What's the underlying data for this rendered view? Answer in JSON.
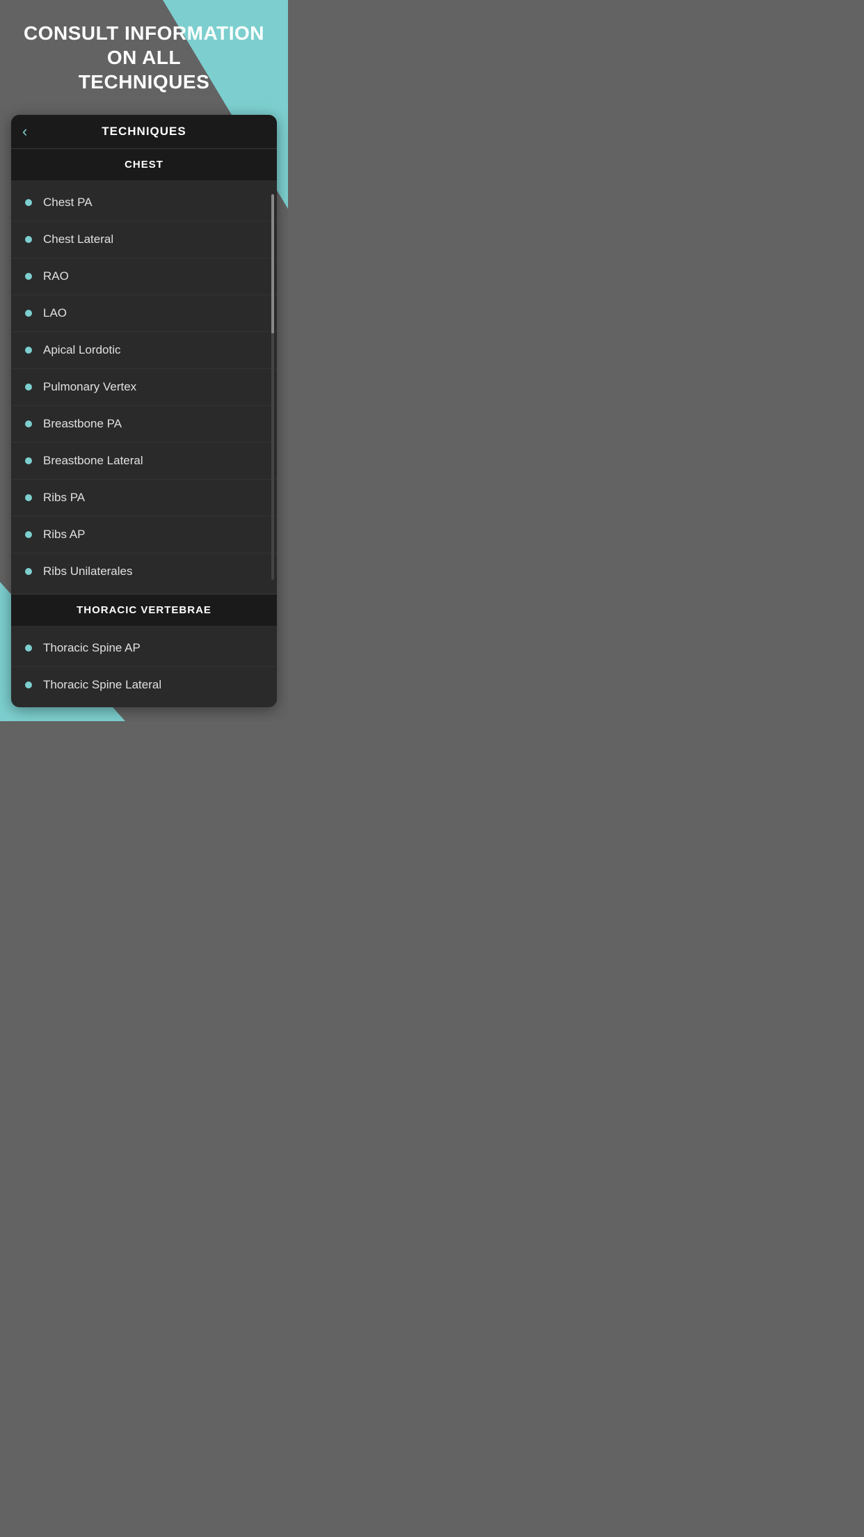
{
  "header": {
    "title": "CONSULT INFORMATION\nON ALL\nTECHNIQUES",
    "title_line1": "CONSULT INFORMATION",
    "title_line2": "ON ALL",
    "title_line3": "TECHNIQUES"
  },
  "card": {
    "nav_title": "TECHNIQUES",
    "back_label": "‹",
    "sections": [
      {
        "id": "chest",
        "label": "CHEST",
        "items": [
          {
            "id": "chest-pa",
            "label": "Chest PA"
          },
          {
            "id": "chest-lateral",
            "label": "Chest Lateral"
          },
          {
            "id": "rao",
            "label": "RAO"
          },
          {
            "id": "lao",
            "label": "LAO"
          },
          {
            "id": "apical-lordotic",
            "label": "Apical Lordotic"
          },
          {
            "id": "pulmonary-vertex",
            "label": "Pulmonary Vertex"
          },
          {
            "id": "breastbone-pa",
            "label": "Breastbone PA"
          },
          {
            "id": "breastbone-lateral",
            "label": "Breastbone Lateral"
          },
          {
            "id": "ribs-pa",
            "label": "Ribs PA"
          },
          {
            "id": "ribs-ap",
            "label": "Ribs AP"
          },
          {
            "id": "ribs-unilaterales",
            "label": "Ribs Unilaterales"
          }
        ]
      },
      {
        "id": "thoracic-vertebrae",
        "label": "THORACIC VERTEBRAE",
        "items": [
          {
            "id": "thoracic-spine-ap",
            "label": "Thoracic Spine AP"
          },
          {
            "id": "thoracic-spine-lateral",
            "label": "Thoracic Spine Lateral"
          }
        ]
      }
    ]
  },
  "colors": {
    "teal": "#7dcfcf",
    "background": "#636363",
    "card_bg": "#2a2a2a",
    "header_bg": "#1a1a1a",
    "text_primary": "#ffffff",
    "text_secondary": "#e0e0e0",
    "divider": "#333333"
  }
}
